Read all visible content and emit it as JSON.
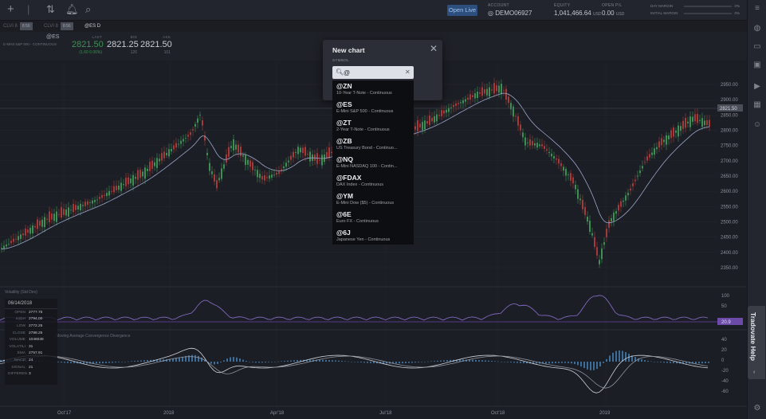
{
  "topbar": {
    "open_live_label": "Open Live",
    "account_label": "ACCOUNT",
    "account_value": "DEMO06927",
    "equity_label": "EQUITY",
    "equity_value": "1,041,466.64",
    "equity_unit": "USD",
    "open_pl_label": "OPEN P/L",
    "open_pl_value": "0.00",
    "open_pl_unit": "USD",
    "day_margin_label": "DAY MARGIN",
    "day_margin_pct": "0%",
    "initial_margin_label": "INITIAL MARGIN",
    "initial_margin_pct": "0%"
  },
  "tabs": [
    {
      "label": "CLVI 8",
      "badge": "8:56"
    },
    {
      "label": "CLVI 8",
      "badge": "8:56"
    },
    {
      "label": "@ES D",
      "badge": ""
    }
  ],
  "quote": {
    "symbol": "@ES",
    "description": "E-MINI S&P 500 - CONTINUOUS",
    "last_label": "LAST",
    "last_value": "2821.50",
    "last_change": "(1.60 0.06%)",
    "bid_label": "BID",
    "bid_value": "2821.25",
    "bid_size": "126",
    "ask_label": "ASK",
    "ask_value": "2821.50",
    "ask_size": "101"
  },
  "chart": {
    "price_ticks": [
      "2950.00",
      "2900.00",
      "2850.00",
      "2800.00",
      "2750.00",
      "2700.00",
      "2650.00",
      "2600.00",
      "2550.00",
      "2500.00",
      "2450.00",
      "2400.00",
      "2350.00"
    ],
    "price_tag": "2821.50",
    "x_ticks": [
      "Oct'17",
      "2018",
      "Apr'18",
      "Jul'18",
      "Oct'18",
      "2019"
    ],
    "vol_label": "Volatility (Std Dev)",
    "vol_ticks": [
      "100",
      "50"
    ],
    "vol_tag": "20.9",
    "macd_label": "Moving Average Convergence Divergence",
    "macd_ticks": [
      "40",
      "20",
      "0",
      "-20",
      "-40",
      "-60"
    ]
  },
  "data_panel": {
    "date": "06/14/2018",
    "rows": [
      {
        "k": "OPEN",
        "v": "2777.75"
      },
      {
        "k": "HIGH",
        "v": "2794.00"
      },
      {
        "k": "LOW",
        "v": "2772.25"
      },
      {
        "k": "CLOSE",
        "v": "2788.25"
      },
      {
        "k": "VOLUME",
        "v": "1046038"
      },
      {
        "k": "VOLATILI",
        "v": "31"
      },
      {
        "k": "EMA",
        "v": "2757.91"
      },
      {
        "k": "MACD",
        "v": "24"
      },
      {
        "k": "SIGNAL",
        "v": "21"
      },
      {
        "k": "DIFFEREN",
        "v": "3"
      }
    ]
  },
  "modal": {
    "title": "New chart",
    "symbol_label": "SYMBOL",
    "search_value": "@"
  },
  "results": [
    {
      "sym": "@ZN",
      "desc": "10-Year T-Note - Continuous"
    },
    {
      "sym": "@ES",
      "desc": "E-Mini S&P 500 - Continuous"
    },
    {
      "sym": "@ZT",
      "desc": "2-Year T-Note - Continuous"
    },
    {
      "sym": "@ZB",
      "desc": "US Treasury Bond - Continuo..."
    },
    {
      "sym": "@NQ",
      "desc": "E-Mini NASDAQ 100 - Contin..."
    },
    {
      "sym": "@FDAX",
      "desc": "DAX Index - Continuous"
    },
    {
      "sym": "@YM",
      "desc": "E-Mini Dow ($5) - Continuous"
    },
    {
      "sym": "@6E",
      "desc": "Euro FX - Continuous"
    },
    {
      "sym": "@6J",
      "desc": "Japanese Yen - Continuous"
    }
  ],
  "help": {
    "label": "Tradovate Help"
  }
}
